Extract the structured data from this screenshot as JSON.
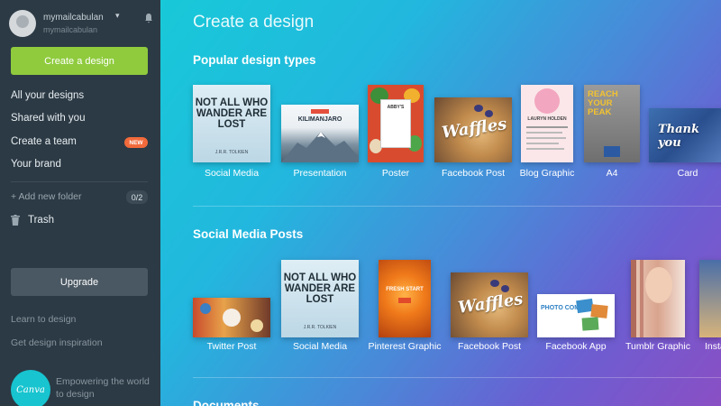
{
  "user": {
    "name": "mymailcabulan",
    "subtext": "mymailcabulan"
  },
  "sidebar": {
    "create_label": "Create a design",
    "items": [
      {
        "label": "All your designs"
      },
      {
        "label": "Shared with you"
      },
      {
        "label": "Create a team",
        "badge": "NEW"
      },
      {
        "label": "Your brand"
      }
    ],
    "add_folder": "+ Add new folder",
    "folder_count": "0/2",
    "trash": "Trash",
    "upgrade": "Upgrade",
    "links": [
      "Learn to design",
      "Get design inspiration"
    ],
    "logo_text": "Canva",
    "tagline": "Empowering the world to design"
  },
  "main": {
    "page_title": "Create a design",
    "sections": [
      {
        "title": "Popular design types",
        "items": [
          "Social Media",
          "Presentation",
          "Poster",
          "Facebook Post",
          "Blog Graphic",
          "A4",
          "Card"
        ]
      },
      {
        "title": "Social Media Posts",
        "items": [
          "Twitter Post",
          "Social Media",
          "Pinterest Graphic",
          "Facebook Post",
          "Facebook App",
          "Tumblr Graphic",
          "Insta"
        ]
      }
    ],
    "third_section_title": "Documents"
  },
  "thumbs": {
    "quote": "NOT ALL WHO WANDER ARE LOST",
    "quote_author": "J.R.R. TOLKIEN",
    "presentation_title": "KILIMANJARO",
    "poster_title": "ABBY'S",
    "waffles": "Waffles",
    "blog_name": "LAURYN HOLDEN",
    "a4_text": "REACH YOUR PEAK",
    "card_text": "Thank you",
    "pinterest_text": "FRESH START",
    "photo_comp": "PHOTO COMP"
  },
  "colors": {
    "accent_green": "#8fcb3d",
    "new_badge": "#f26a3b",
    "sidebar": "#2c3a45"
  }
}
